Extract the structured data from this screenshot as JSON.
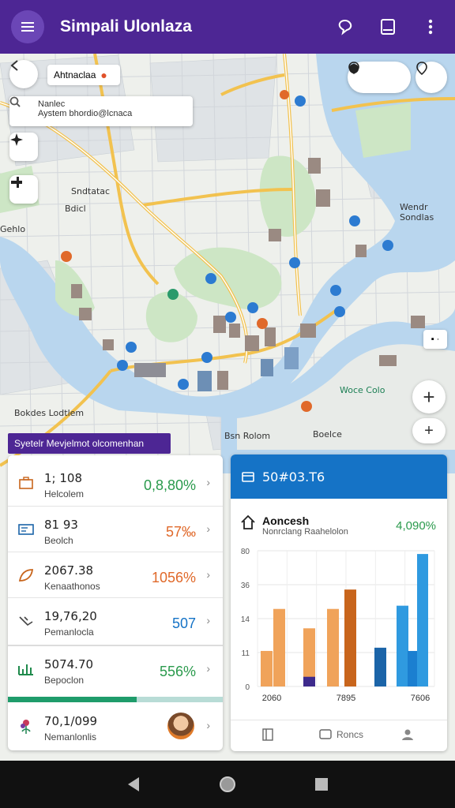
{
  "app_bar": {
    "title": "Simpali Ulonlaza",
    "icons": [
      "menu-icon",
      "chat-icon",
      "tablet-icon",
      "more-vert-icon"
    ]
  },
  "map": {
    "location_chip": "Ahtnaclaa",
    "search": {
      "line1": "Nanlec",
      "line2": "Aystem bhordio@lcnaca"
    },
    "labels": [
      {
        "key": "bdicl",
        "text": "Bdicl"
      },
      {
        "key": "gehlo",
        "text": "Gehlo"
      },
      {
        "key": "sndtatac",
        "text": "Sndtatac"
      },
      {
        "key": "wendr",
        "text": "Wendr Sondlas"
      },
      {
        "key": "woce",
        "text": "Woce Colo"
      },
      {
        "key": "bokdes",
        "text": "Bokdes Lodtlem"
      },
      {
        "key": "bsn",
        "text": "Bsn Rolom"
      },
      {
        "key": "b2",
        "text": "Boelce"
      },
      {
        "key": "pill",
        "text": "▪ ·"
      }
    ],
    "zoom_in": "+",
    "zoom_out": "+"
  },
  "stats": {
    "banner": "Syetelr Mevjelmot olcomenhan",
    "rows": [
      {
        "value": "1; 108",
        "label": "Helcolem",
        "pct": "0,8,80%",
        "pct_color": "#2a9a4c",
        "icon": "briefcase-icon"
      },
      {
        "value": "81 93",
        "label": "Beolch",
        "pct": "57‰",
        "pct_color": "#e0692a",
        "icon": "id-card-icon"
      },
      {
        "value": "2067.38",
        "label": "Kenaathonos",
        "pct": "1056%",
        "pct_color": "#e0692a",
        "icon": "leaf-icon"
      },
      {
        "value": "19,76,20",
        "label": "Pemanlocla",
        "pct": "507",
        "pct_color": "#1573c6",
        "icon": "handshake-icon"
      },
      {
        "value": "5074.70",
        "label": "Bepoclon",
        "pct": "556%",
        "pct_color": "#2a9a4c",
        "icon": "bar-chart-icon"
      },
      {
        "value": "70,1/099",
        "label": "Nemanlonlis",
        "icon": "flower-icon"
      }
    ],
    "progress": 0.6
  },
  "chart_card": {
    "header": "50#03.T6",
    "title": "Aoncesh",
    "subtitle": "Nonrclang Raahelolon",
    "pct": "4,090%",
    "footer": [
      "",
      "Roncs",
      ""
    ]
  },
  "chart_data": {
    "type": "bar",
    "y_ticks": [
      "80",
      "36",
      "14",
      "11",
      "0"
    ],
    "x_labels": [
      "2060",
      "7895",
      "7606"
    ],
    "bars": [
      {
        "value": 11,
        "color": "#f0a35a"
      },
      {
        "value": 24,
        "color": "#f0a35a"
      },
      {
        "value": 18,
        "color": "#f0a35a"
      },
      {
        "value": 3,
        "color": "#3d2a8c"
      },
      {
        "value": 24,
        "color": "#f0a35a"
      },
      {
        "value": 30,
        "color": "#c8651c"
      },
      {
        "value": 12,
        "color": "#1b64a8"
      },
      {
        "value": 25,
        "color": "#2f9ae0"
      },
      {
        "value": 11,
        "color": "#1b7fd0"
      },
      {
        "value": 41,
        "color": "#2f9ae0"
      }
    ],
    "ylim": [
      0,
      42
    ],
    "grid": true
  }
}
